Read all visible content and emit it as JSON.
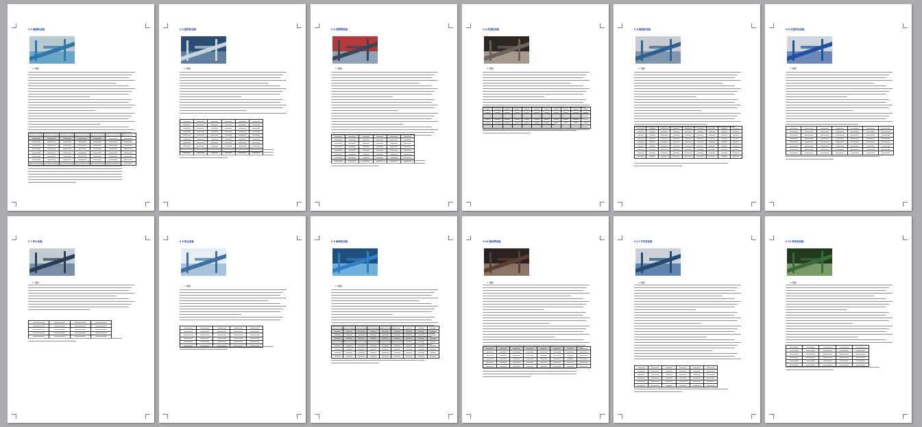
{
  "document": {
    "view": "multi-page thumbnail preview",
    "pages": [
      {
        "heading": "2.1 输送机设备",
        "photo": "conveyor-belt",
        "label": "1. 用途"
      },
      {
        "heading": "2.2 给料机设备",
        "photo": "feeder-hall",
        "label": "1. 用途"
      },
      {
        "heading": "2.3 滚筒筛设备",
        "photo": "drum-screen",
        "label": "1. 用途"
      },
      {
        "heading": "2.4 风选机设备",
        "photo": "wind-separator",
        "label": "1. 用途"
      },
      {
        "heading": "2.5 磁选机设备",
        "photo": "magnetic-separator",
        "label": "1. 用途"
      },
      {
        "heading": "2.6 分选平台设备",
        "photo": "sorting-platform",
        "label": "1. 用途"
      },
      {
        "heading": "2.7 料斗设备",
        "photo": "hopper",
        "label": "1. 用途"
      },
      {
        "heading": "2.8 除尘设备",
        "photo": "dust-removal",
        "label": "1. 用途"
      },
      {
        "heading": "2.9 破碎机设备",
        "photo": "crusher",
        "label": "1. 用途"
      },
      {
        "heading": "2.10 振动筛设备",
        "photo": "vibrating-screen",
        "label": "1. 用途"
      },
      {
        "heading": "2.11 打包机设备",
        "photo": "baler-frame",
        "label": "1. 用途"
      },
      {
        "heading": "2.12 剪切机设备",
        "photo": "shredder",
        "label": "1. 用途"
      }
    ]
  }
}
